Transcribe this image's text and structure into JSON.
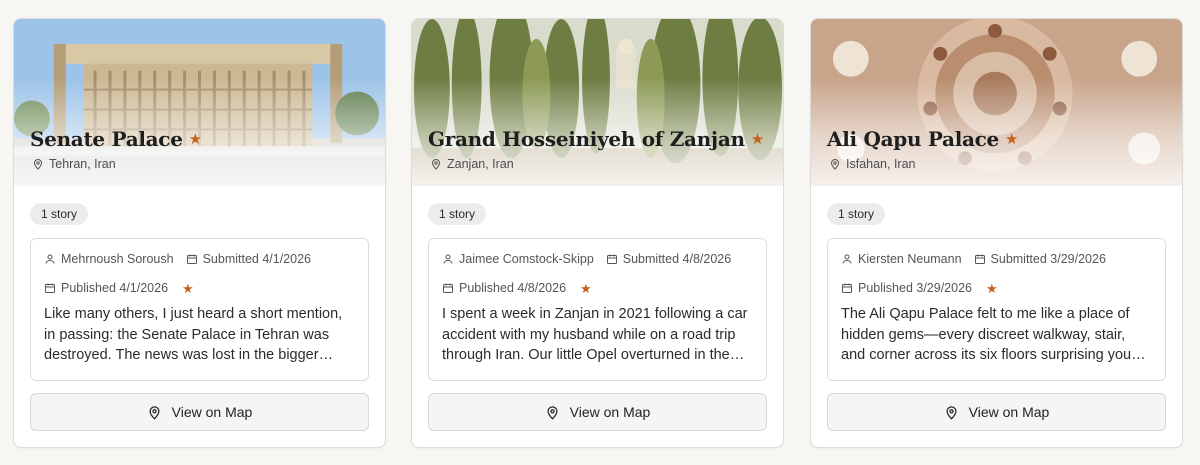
{
  "colors": {
    "accent_star": "#c8601a",
    "card_border": "#dcdcdc",
    "background": "#f7f6f3"
  },
  "icons": {
    "location": "map-pin-icon",
    "author": "user-icon",
    "date": "calendar-icon",
    "favorite": "star-icon"
  },
  "cards": [
    {
      "title": "Senate Palace",
      "location": "Tehran, Iran",
      "story_count": "1 story",
      "author": "Mehrnoush Soroush",
      "submitted": "Submitted 4/1/2026",
      "published": "Published 4/1/2026",
      "excerpt": "Like many others, I just heard a short mention, in passing: the Senate Palace in Tehran was destroyed. The news was lost in the bigger news of the war.",
      "button": "View on Map"
    },
    {
      "title": "Grand Hosseiniyeh of Zanjan",
      "location": "Zanjan, Iran",
      "story_count": "1 story",
      "author": "Jaimee Comstock-Skipp",
      "submitted": "Submitted 4/8/2026",
      "published": "Published 4/8/2026",
      "excerpt": "I spent a week in Zanjan in 2021 following a car accident with my husband while on a road trip through Iran. Our little Opel overturned in the desert.",
      "button": "View on Map"
    },
    {
      "title": "Ali Qapu Palace",
      "location": "Isfahan, Iran",
      "story_count": "1 story",
      "author": "Kiersten Neumann",
      "submitted": "Submitted 3/29/2026",
      "published": "Published 3/29/2026",
      "excerpt": "The Ali Qapu Palace felt to me like a place of hidden gems—every discreet walkway, stair, and corner across its six floors surprising you with something new.",
      "button": "View on Map"
    }
  ]
}
